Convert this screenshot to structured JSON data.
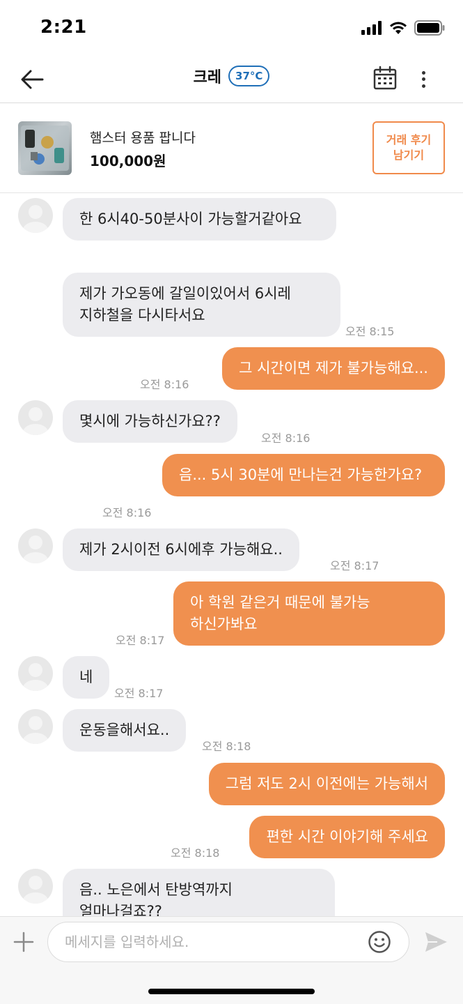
{
  "status_bar": {
    "time": "2:21"
  },
  "header": {
    "title": "크레",
    "temperature": "37°C"
  },
  "product": {
    "name": "햄스터 용품 팝니다",
    "price": "100,000원",
    "review_label_1": "거래 후기",
    "review_label_2": "남기기"
  },
  "messages": [
    {
      "side": "in",
      "text": "한 6시40-50분사이 가능할거같아요",
      "time": ""
    },
    {
      "side": "in",
      "text": "제가 가오동에 갈일이있어서 6시레 지하철을 다시타서요",
      "time": "오전 8:15"
    },
    {
      "side": "out",
      "text": "그 시간이면 제가 불가능해요...",
      "time": "오전 8:16"
    },
    {
      "side": "in",
      "text": "몇시에 가능하신가요??",
      "time": "오전 8:16"
    },
    {
      "side": "out",
      "text": "음... 5시 30분에 만나는건 가능한가요?",
      "time": "오전 8:16"
    },
    {
      "side": "in",
      "text": "제가 2시이전 6시에후 가능해요..",
      "time": "오전 8:17"
    },
    {
      "side": "out",
      "text": "아 학원 같은거 때문에 불가능 하신가봐요",
      "time": "오전 8:17"
    },
    {
      "side": "in",
      "text": "네",
      "time": "오전 8:17"
    },
    {
      "side": "in",
      "text": "운동을해서요..",
      "time": "오전 8:18"
    },
    {
      "side": "out",
      "text": "그럼 저도 2시 이전에는 가능해서",
      "time": ""
    },
    {
      "side": "out",
      "text": "편한 시간 이야기해 주세요",
      "time": "오전 8:18"
    },
    {
      "side": "in",
      "text": "음.. 노은에서 탄방역까지 얼마나걸죠??",
      "time": ""
    }
  ],
  "input": {
    "placeholder": "메세지를 입력하세요.",
    "value": ""
  },
  "icons": {
    "back": "arrow-left-icon",
    "calendar": "calendar-icon",
    "more": "more-vertical-icon",
    "plus": "plus-icon",
    "emoji": "smiley-icon",
    "send": "send-icon"
  },
  "colors": {
    "accent": "#f0904f",
    "temp_badge": "#1f6fb8",
    "incoming_bubble": "#ececef"
  }
}
